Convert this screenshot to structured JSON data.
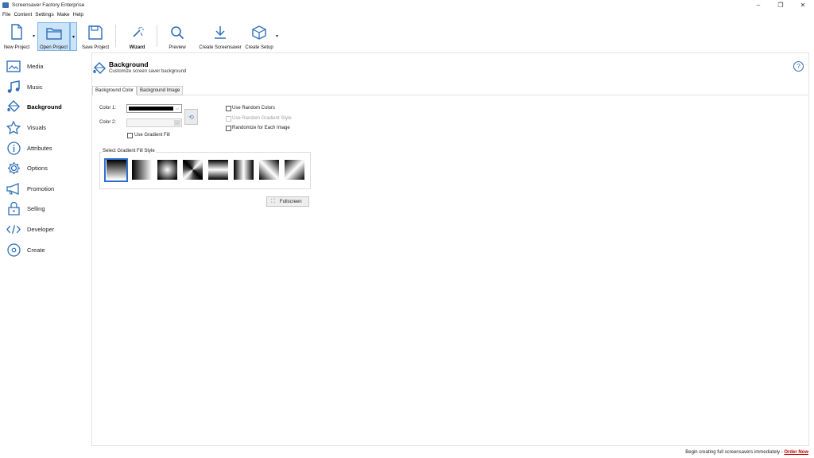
{
  "window": {
    "title": "Screensaver Factory Enterprise",
    "minimize": "–",
    "restore": "❐",
    "close": "✕"
  },
  "menu": [
    "File",
    "Content",
    "Settings",
    "Make",
    "Help"
  ],
  "toolbar": {
    "new_project": "New Project",
    "open_project": "Open Project",
    "save_project": "Save Project",
    "wizard": "Wizard",
    "preview": "Preview",
    "create_screensaver": "Create Screensaver",
    "create_setup": "Create Setup",
    "dropdown_glyph": "▾"
  },
  "sidebar": [
    {
      "label": "Media",
      "icon": "image-icon"
    },
    {
      "label": "Music",
      "icon": "music-note-icon"
    },
    {
      "label": "Background",
      "icon": "paint-bucket-icon",
      "active": true
    },
    {
      "label": "Visuals",
      "icon": "star-icon"
    },
    {
      "label": "Attributes",
      "icon": "info-icon"
    },
    {
      "label": "Options",
      "icon": "gear-icon"
    },
    {
      "label": "Promotion",
      "icon": "megaphone-icon"
    },
    {
      "label": "Selling",
      "icon": "lock-icon"
    },
    {
      "label": "Developer",
      "icon": "code-icon"
    },
    {
      "label": "Create",
      "icon": "disc-icon"
    }
  ],
  "header": {
    "title": "Background",
    "subtitle": "Customize screen saver background",
    "help": "?"
  },
  "tabs": [
    "Background Color",
    "Background Image"
  ],
  "form": {
    "color1_label": "Color 1:",
    "color2_label": "Color 2:",
    "color1_value": "#000000",
    "use_gradient_fill": "Use Gradient Fill",
    "use_random_colors": "Use Random Colors",
    "use_random_gradient_style": "Use Random Gradient Style",
    "randomize_each_image": "Randomize for Each Image",
    "gradient_group_label": "Select Gradient Fill Style",
    "fullscreen": "Fullscreen"
  },
  "gradient_styles": [
    "vertical",
    "horizontal",
    "radial",
    "box",
    "horizontal-mirror",
    "vertical-mirror",
    "diagonal-cross",
    "diagonal"
  ],
  "gradient_selected_index": 0,
  "status": {
    "text": "Begin creating full screensavers immediately - ",
    "link": "Order Now"
  },
  "colors": {
    "accent": "#2a6fd0",
    "selected_bg": "#cce4f7",
    "link": "#c00000"
  }
}
